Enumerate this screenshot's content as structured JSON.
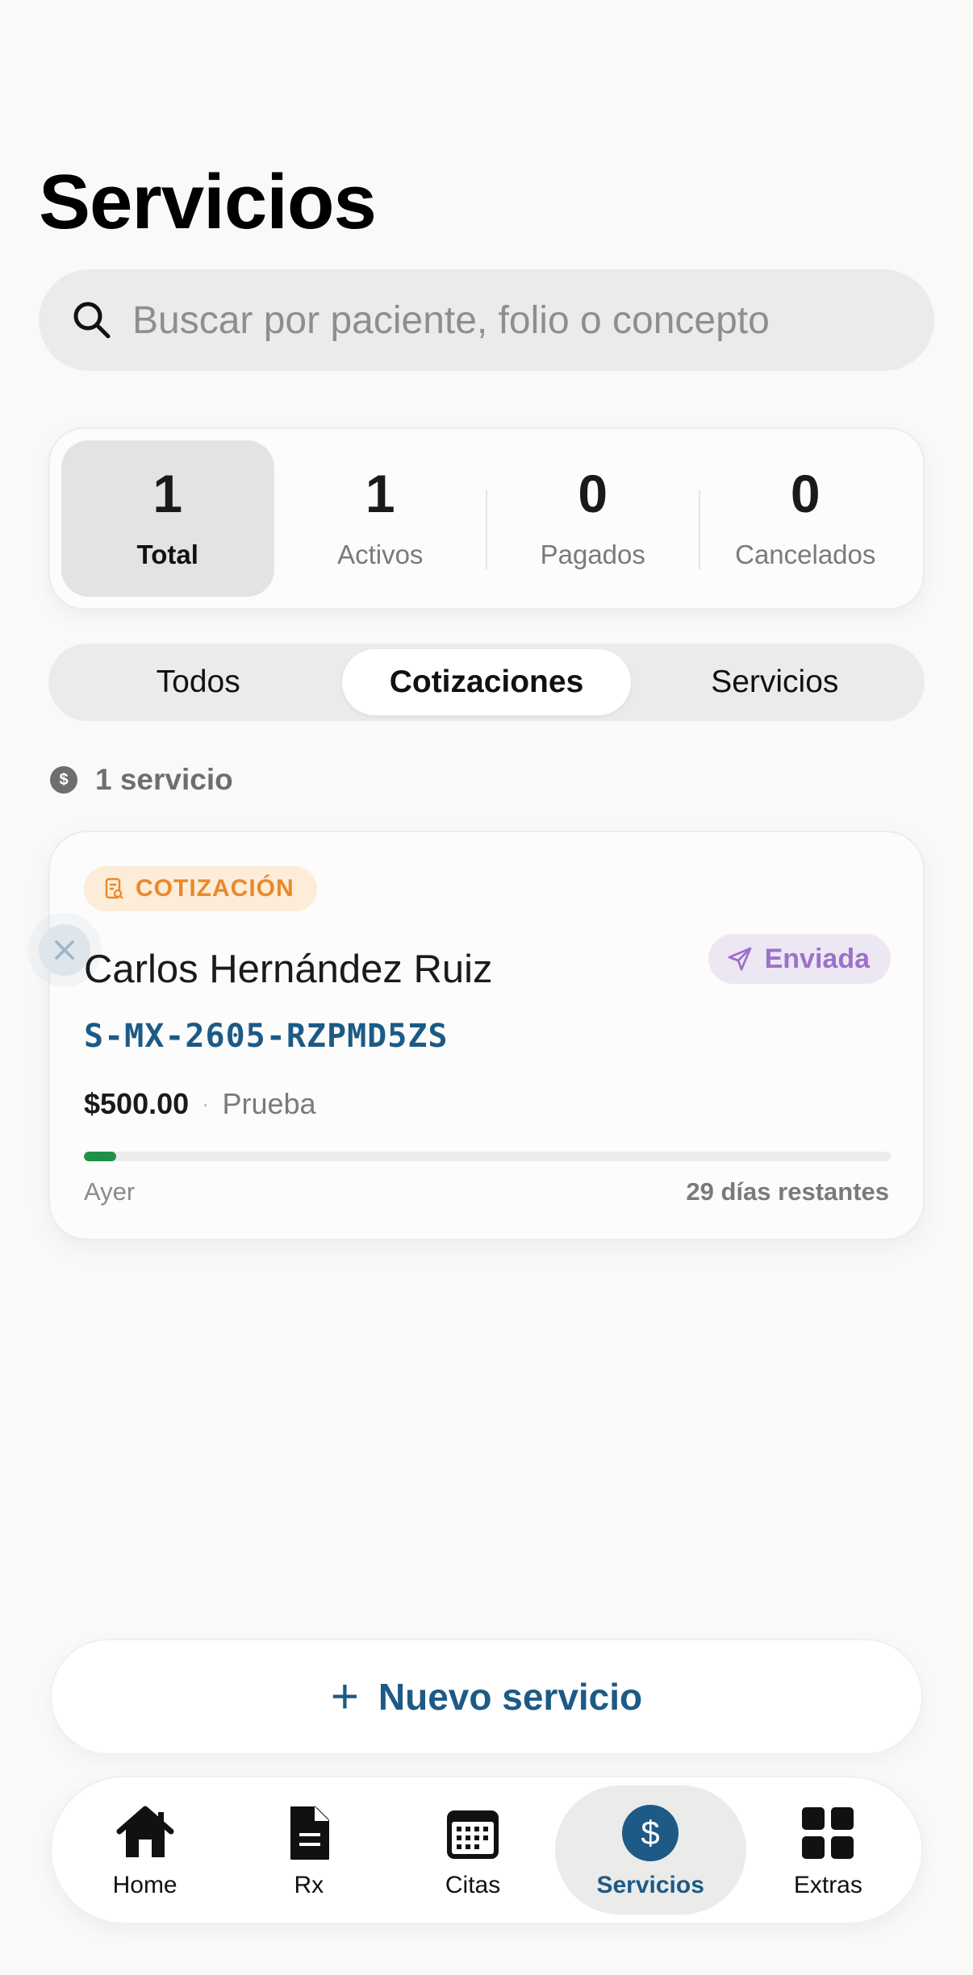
{
  "header": {
    "title": "Servicios"
  },
  "search": {
    "placeholder": "Buscar por paciente, folio o concepto"
  },
  "stats": [
    {
      "value": "1",
      "label": "Total"
    },
    {
      "value": "1",
      "label": "Activos"
    },
    {
      "value": "0",
      "label": "Pagados"
    },
    {
      "value": "0",
      "label": "Cancelados"
    }
  ],
  "segments": [
    "Todos",
    "Cotizaciones",
    "Servicios"
  ],
  "selected_segment": "Cotizaciones",
  "count_label": "1 servicio",
  "card": {
    "type_badge": "COTIZACIÓN",
    "patient": "Carlos Hernández Ruiz",
    "status": "Enviada",
    "folio": "S-MX-2605-RZPMD5ZS",
    "amount": "$500.00",
    "separator": "·",
    "concept": "Prueba",
    "progress_fraction": 0.04,
    "created": "Ayer",
    "remaining": "29 días restantes"
  },
  "actions": {
    "new_service": "Nuevo servicio"
  },
  "tabbar": [
    {
      "label": "Home",
      "icon": "home-icon"
    },
    {
      "label": "Rx",
      "icon": "document-icon"
    },
    {
      "label": "Citas",
      "icon": "calendar-icon"
    },
    {
      "label": "Servicios",
      "icon": "dollar-icon"
    },
    {
      "label": "Extras",
      "icon": "grid-icon"
    }
  ],
  "colors": {
    "accent": "#1d5a86",
    "quote_badge": "#e8892c",
    "status_sent": "#9b72c9",
    "progress": "#1f9147"
  }
}
